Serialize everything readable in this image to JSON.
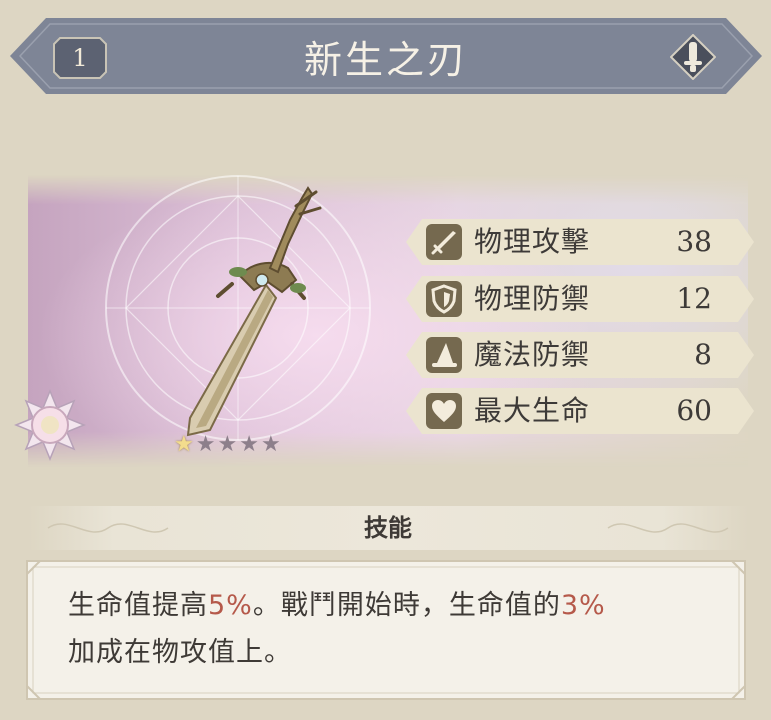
{
  "header": {
    "level": "1",
    "title": "新生之刃",
    "lock_icon": "lock-icon"
  },
  "item": {
    "rarity_total": 5,
    "rarity_filled": 1,
    "star_glyph": "★",
    "emblem_icon": "flower-emblem-icon"
  },
  "stats": [
    {
      "label": "物理攻擊",
      "value": "38",
      "icon": "sword-icon"
    },
    {
      "label": "物理防禦",
      "value": "12",
      "icon": "shield-icon"
    },
    {
      "label": "魔法防禦",
      "value": "8",
      "icon": "wizard-hat-icon"
    },
    {
      "label": "最大生命",
      "value": "60",
      "icon": "heart-icon"
    }
  ],
  "skill": {
    "title": "技能",
    "desc_part1": "生命值提高",
    "desc_hl1": "5%",
    "desc_part2": "。戰鬥開始時，生命值的",
    "desc_hl2": "3%",
    "desc_part3": "加成在物攻值上。"
  },
  "colors": {
    "header_bg": "#7e8596",
    "badge_bg": "#5c6272",
    "stat_bg": "#ebe4cf",
    "icon_bg": "#75694f",
    "highlight": "#b5594a",
    "page_bg": "#ddd6c3"
  }
}
